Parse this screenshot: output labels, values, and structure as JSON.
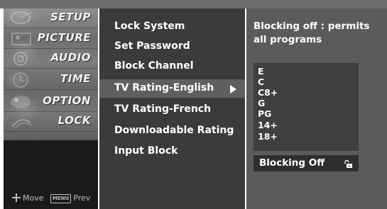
{
  "categories": [
    {
      "label": "SETUP",
      "icon": "satellite-dish-icon"
    },
    {
      "label": "PICTURE",
      "icon": "picture-icon"
    },
    {
      "label": "AUDIO",
      "icon": "speaker-icon"
    },
    {
      "label": "TIME",
      "icon": "clock-icon"
    },
    {
      "label": "OPTION",
      "icon": "option-icon"
    },
    {
      "label": "LOCK",
      "icon": "lock-icon"
    }
  ],
  "footer": {
    "move_label": "Move",
    "menu_key": "MENU",
    "prev_label": "Prev"
  },
  "menu": {
    "items": [
      {
        "label": "Lock System"
      },
      {
        "label": "Set Password"
      },
      {
        "label": "Block Channel"
      },
      {
        "label": "TV Rating-English",
        "selected": true
      },
      {
        "label": "TV Rating-French"
      },
      {
        "label": "Downloadable Rating"
      },
      {
        "label": "Input Block"
      }
    ],
    "submenu_indicator_icon": "triangle-right-icon"
  },
  "detail": {
    "description": "Blocking off : permits all programs",
    "ratings": [
      "E",
      "C",
      "C8+",
      "G",
      "PG",
      "14+",
      "18+"
    ],
    "blocking_label": "Blocking Off",
    "blocking_icon": "unlocked-padlock-icon"
  },
  "colors": {
    "left_panel": "#1a1a1a",
    "menu_panel": "#3b3b3b",
    "menu_selected": "#5f5f5f",
    "detail_panel": "#5b5b5b",
    "ratings_box": "#3f3f3f",
    "text": "#ffffff"
  }
}
